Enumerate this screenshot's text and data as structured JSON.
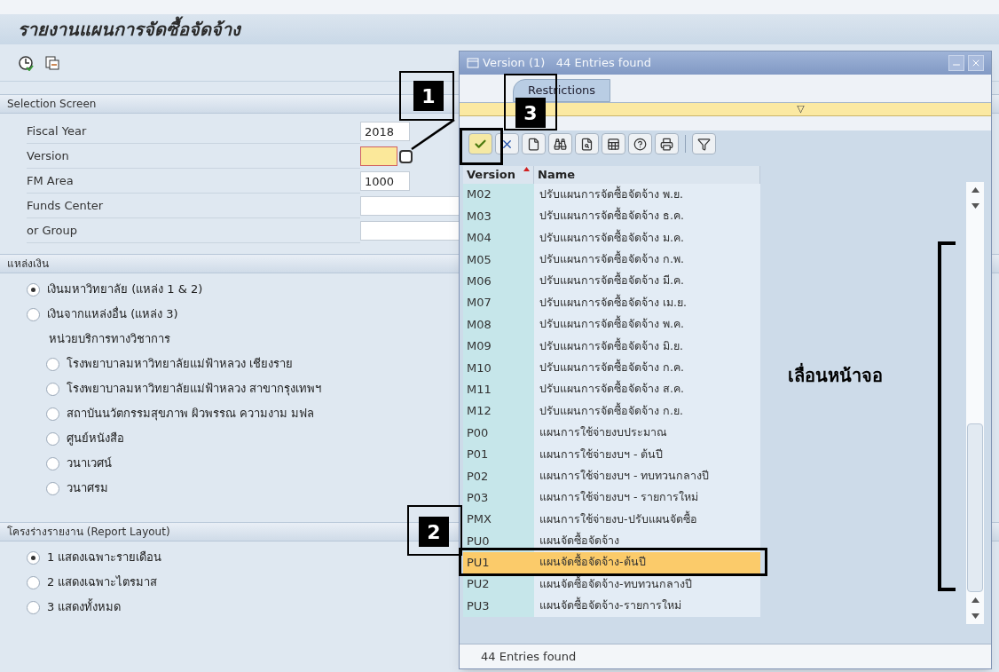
{
  "window": {
    "title": "รายงานแผนการจัดซื้อจัดจ้าง"
  },
  "selection_screen": {
    "title": "Selection Screen",
    "fields": [
      {
        "label": "Fiscal Year",
        "value": "2018",
        "highlighted": false,
        "value_help": false
      },
      {
        "label": "Version",
        "highlighted": true,
        "value_help": true
      },
      {
        "label": "FM Area",
        "value": "1000",
        "highlighted": false,
        "value_help": false
      },
      {
        "label": "Funds Center",
        "highlighted": false
      },
      {
        "label": "or Group",
        "highlighted": false
      }
    ]
  },
  "fund_source": {
    "title": "แหล่งเงิน",
    "options": [
      {
        "label": "เงินมหาวิทยาลัย (แหล่ง 1 & 2)",
        "selected": true
      },
      {
        "label": "เงินจากแหล่งอื่น (แหล่ง 3)",
        "selected": false,
        "sub_heading": "หน่วยบริการทางวิชาการ",
        "children": [
          {
            "label": "โรงพยาบาลมหาวิทยาลัยแม่ฟ้าหลวง เชียงราย",
            "selected": false
          },
          {
            "label": "โรงพยาบาลมหาวิทยาลัยแม่ฟ้าหลวง สาขากรุงเทพฯ",
            "selected": false
          },
          {
            "label": "สถาบันนวัตกรรมสุขภาพ ผิวพรรณ ความงาม มฟล",
            "selected": false
          },
          {
            "label": "ศูนย์หนังสือ",
            "selected": false
          },
          {
            "label": "วนาเวศน์",
            "selected": false
          },
          {
            "label": "วนาศรม",
            "selected": false
          }
        ]
      }
    ]
  },
  "report_layout": {
    "title": "โครงร่างรายงาน (Report Layout)",
    "options": [
      {
        "label": "1 แสดงเฉพาะรายเดือน",
        "selected": true
      },
      {
        "label": "2 แสดงเฉพาะไตรมาส",
        "selected": false
      },
      {
        "label": "3 แสดงทั้งหมด",
        "selected": false
      }
    ]
  },
  "popup": {
    "title": "Version (1)   44 Entries found",
    "tab": "Restrictions",
    "collapse_marker": "▽",
    "table": {
      "columns": [
        {
          "label": "Version",
          "sorted": true
        },
        {
          "label": "Name",
          "sorted": false
        }
      ],
      "rows": [
        {
          "version": "M02",
          "name": "ปรับแผนการจัดซื้อจัดจ้าง พ.ย.",
          "selected": false
        },
        {
          "version": "M03",
          "name": "ปรับแผนการจัดซื้อจัดจ้าง ธ.ค.",
          "selected": false
        },
        {
          "version": "M04",
          "name": "ปรับแผนการจัดซื้อจัดจ้าง ม.ค.",
          "selected": false
        },
        {
          "version": "M05",
          "name": "ปรับแผนการจัดซื้อจัดจ้าง ก.พ.",
          "selected": false
        },
        {
          "version": "M06",
          "name": "ปรับแผนการจัดซื้อจัดจ้าง มี.ค.",
          "selected": false
        },
        {
          "version": "M07",
          "name": "ปรับแผนการจัดซื้อจัดจ้าง เม.ย.",
          "selected": false
        },
        {
          "version": "M08",
          "name": "ปรับแผนการจัดซื้อจัดจ้าง พ.ค.",
          "selected": false
        },
        {
          "version": "M09",
          "name": "ปรับแผนการจัดซื้อจัดจ้าง มิ.ย.",
          "selected": false
        },
        {
          "version": "M10",
          "name": "ปรับแผนการจัดซื้อจัดจ้าง ก.ค.",
          "selected": false
        },
        {
          "version": "M11",
          "name": "ปรับแผนการจัดซื้อจัดจ้าง ส.ค.",
          "selected": false
        },
        {
          "version": "M12",
          "name": "ปรับแผนการจัดซื้อจัดจ้าง ก.ย.",
          "selected": false
        },
        {
          "version": "P00",
          "name": "แผนการใช้จ่ายงบประมาณ",
          "selected": false
        },
        {
          "version": "P01",
          "name": "แผนการใช้จ่ายงบฯ - ต้นปี",
          "selected": false
        },
        {
          "version": "P02",
          "name": "แผนการใช้จ่ายงบฯ - ทบทวนกลางปี",
          "selected": false
        },
        {
          "version": "P03",
          "name": "แผนการใช้จ่ายงบฯ - รายการใหม่",
          "selected": false
        },
        {
          "version": "PMX",
          "name": "แผนการใช้จ่ายงบ-ปรับแผนจัดซื้อ",
          "selected": false
        },
        {
          "version": "PU0",
          "name": "แผนจัดซื้อจัดจ้าง",
          "selected": false
        },
        {
          "version": "PU1",
          "name": "แผนจัดซื้อจัดจ้าง-ต้นปี",
          "selected": true
        },
        {
          "version": "PU2",
          "name": "แผนจัดซื้อจัดจ้าง-ทบทวนกลางปี",
          "selected": false
        },
        {
          "version": "PU3",
          "name": "แผนจัดซื้อจัดจ้าง-รายการใหม่",
          "selected": false
        }
      ]
    },
    "status_bar": "44 Entries found"
  },
  "annotations": {
    "steps": [
      "1",
      "2",
      "3"
    ],
    "scroll_note": "เลื่อนหน้าจอ"
  }
}
